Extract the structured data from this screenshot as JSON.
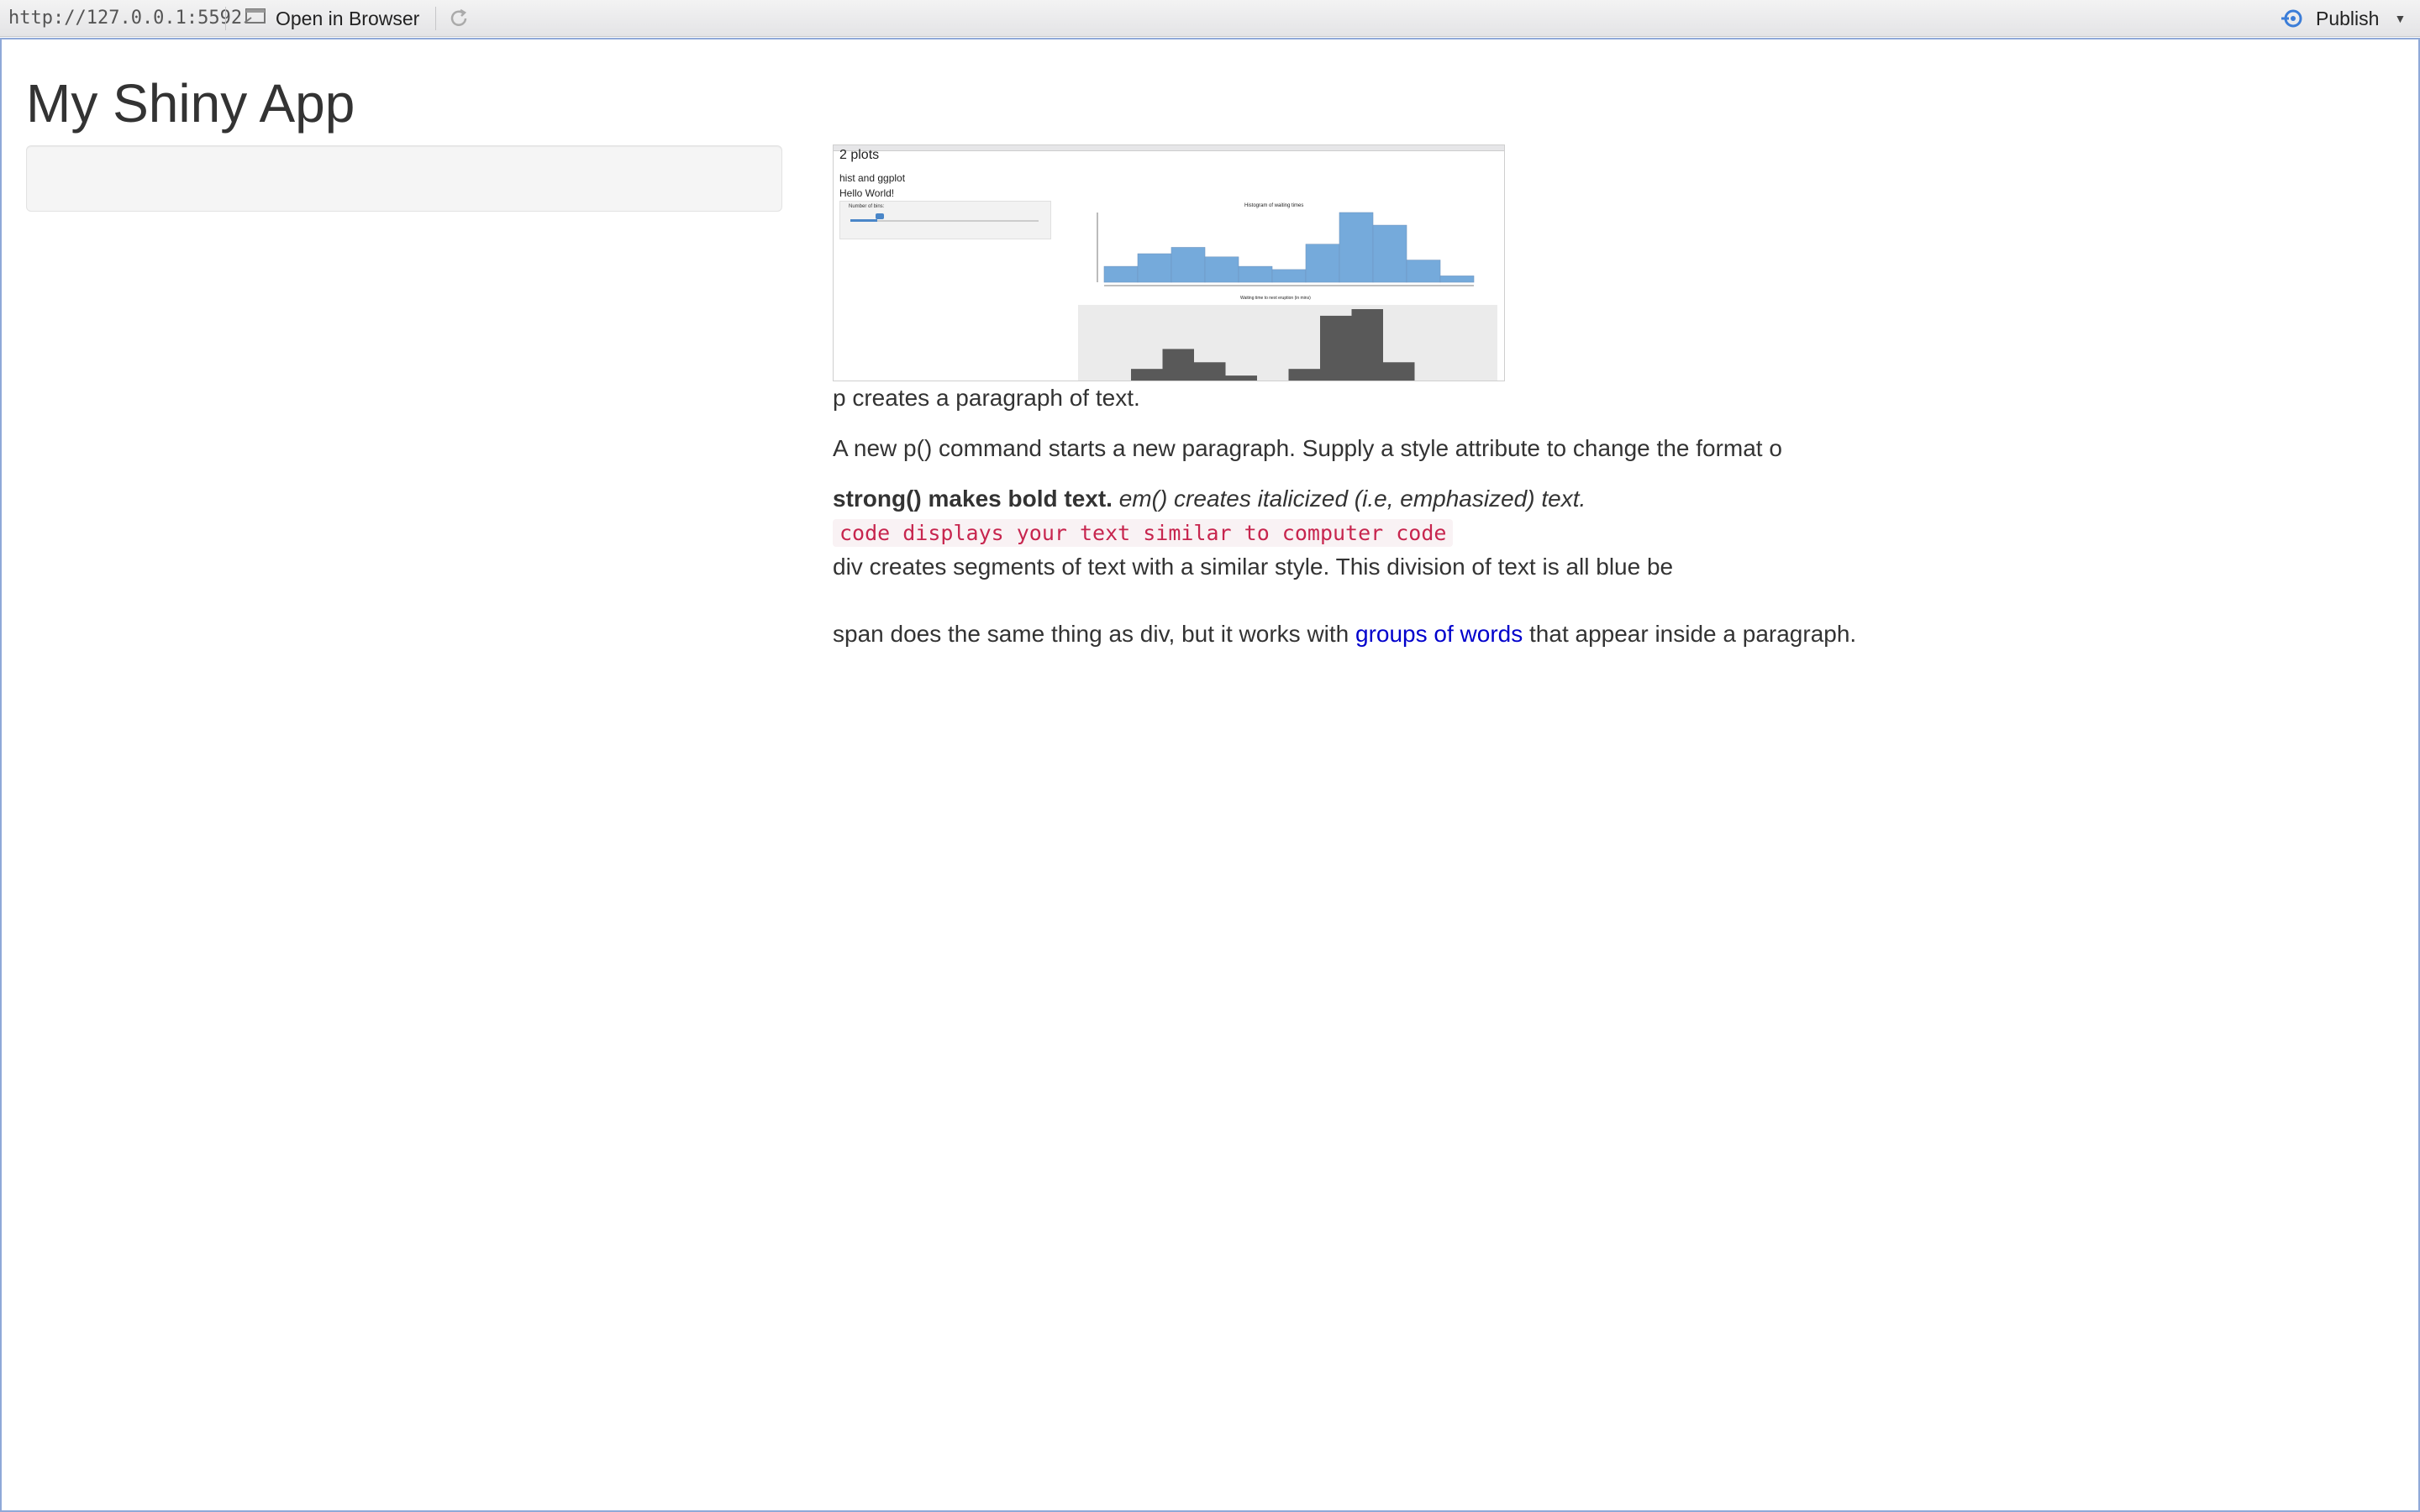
{
  "toolbar": {
    "url": "http://127.0.0.1:5592",
    "open_in_browser_label": "Open in Browser",
    "publish_label": "Publish",
    "publish_icon": "publish-icon",
    "open_icon": "open-in-browser-icon",
    "refresh_icon": "refresh-icon",
    "accent_color": "#3b7dd8"
  },
  "app": {
    "title": "My Shiny App"
  },
  "embedded_image": {
    "title": "2 plots",
    "line1": "hist and ggplot",
    "line2": "Hello World!",
    "slider_label": "Number of bins:",
    "hist_title": "Histogram of waiting times",
    "gg_caption": "Waiting time to next eruption (in mins)",
    "hist_color": "#75aadb",
    "gg_color": "#595959",
    "hist_bins": [
      5,
      9,
      11,
      8,
      5,
      4,
      12,
      22,
      18,
      7,
      2
    ],
    "gg_bins": [
      2,
      5,
      3,
      1,
      0,
      2,
      10,
      11,
      3
    ]
  },
  "content": {
    "p1": "p creates a paragraph of text.",
    "p2": "A new p() command starts a new paragraph. Supply a style attribute to change the format o",
    "strong": "strong() makes bold text.",
    "em": "em() creates italicized (i.e, emphasized) text.",
    "code": "code displays your text similar to computer code",
    "div_text": "div creates segments of text with a similar style. This division of text is all blue be",
    "span_before": "span does the same thing as div, but it works with ",
    "span_blue": "groups of words",
    "span_after": " that appear inside a paragraph.",
    "span_color": "#0000cc"
  }
}
